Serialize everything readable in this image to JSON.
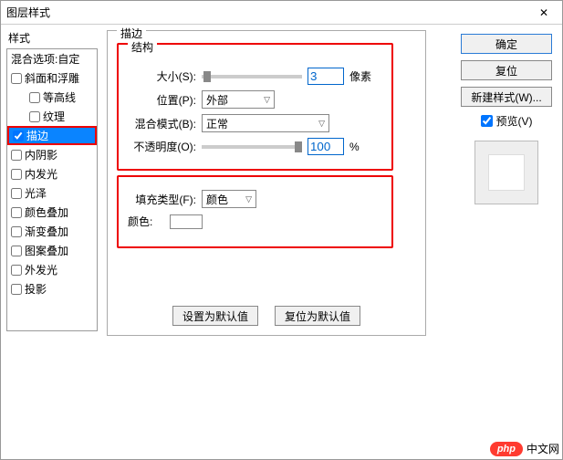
{
  "window": {
    "title": "图层样式",
    "close_icon": "✕"
  },
  "left": {
    "header": "样式",
    "blend_static": "混合选项:自定",
    "items": [
      {
        "label": "斜面和浮雕",
        "checked": false,
        "indent": false
      },
      {
        "label": "等高线",
        "checked": false,
        "indent": true
      },
      {
        "label": "纹理",
        "checked": false,
        "indent": true
      },
      {
        "label": "描边",
        "checked": true,
        "indent": false,
        "selected": true
      },
      {
        "label": "内阴影",
        "checked": false,
        "indent": false
      },
      {
        "label": "内发光",
        "checked": false,
        "indent": false
      },
      {
        "label": "光泽",
        "checked": false,
        "indent": false
      },
      {
        "label": "颜色叠加",
        "checked": false,
        "indent": false
      },
      {
        "label": "渐变叠加",
        "checked": false,
        "indent": false
      },
      {
        "label": "图案叠加",
        "checked": false,
        "indent": false
      },
      {
        "label": "外发光",
        "checked": false,
        "indent": false
      },
      {
        "label": "投影",
        "checked": false,
        "indent": false
      }
    ]
  },
  "stroke": {
    "group_label": "描边",
    "structure_label": "结构",
    "size_label": "大小(S):",
    "size_value": "3",
    "size_unit": "像素",
    "position_label": "位置(P):",
    "position_value": "外部",
    "blend_label": "混合模式(B):",
    "blend_value": "正常",
    "opacity_label": "不透明度(O):",
    "opacity_value": "100",
    "opacity_unit": "%",
    "filltype_label": "填充类型(F):",
    "filltype_value": "颜色",
    "color_label": "颜色:",
    "reset_defaults": "设置为默认值",
    "restore_defaults": "复位为默认值"
  },
  "right": {
    "ok": "确定",
    "cancel": "复位",
    "new_style": "新建样式(W)...",
    "preview_label": "预览(V)",
    "preview_checked": true
  },
  "watermark": {
    "badge": "php",
    "text": "中文网"
  }
}
